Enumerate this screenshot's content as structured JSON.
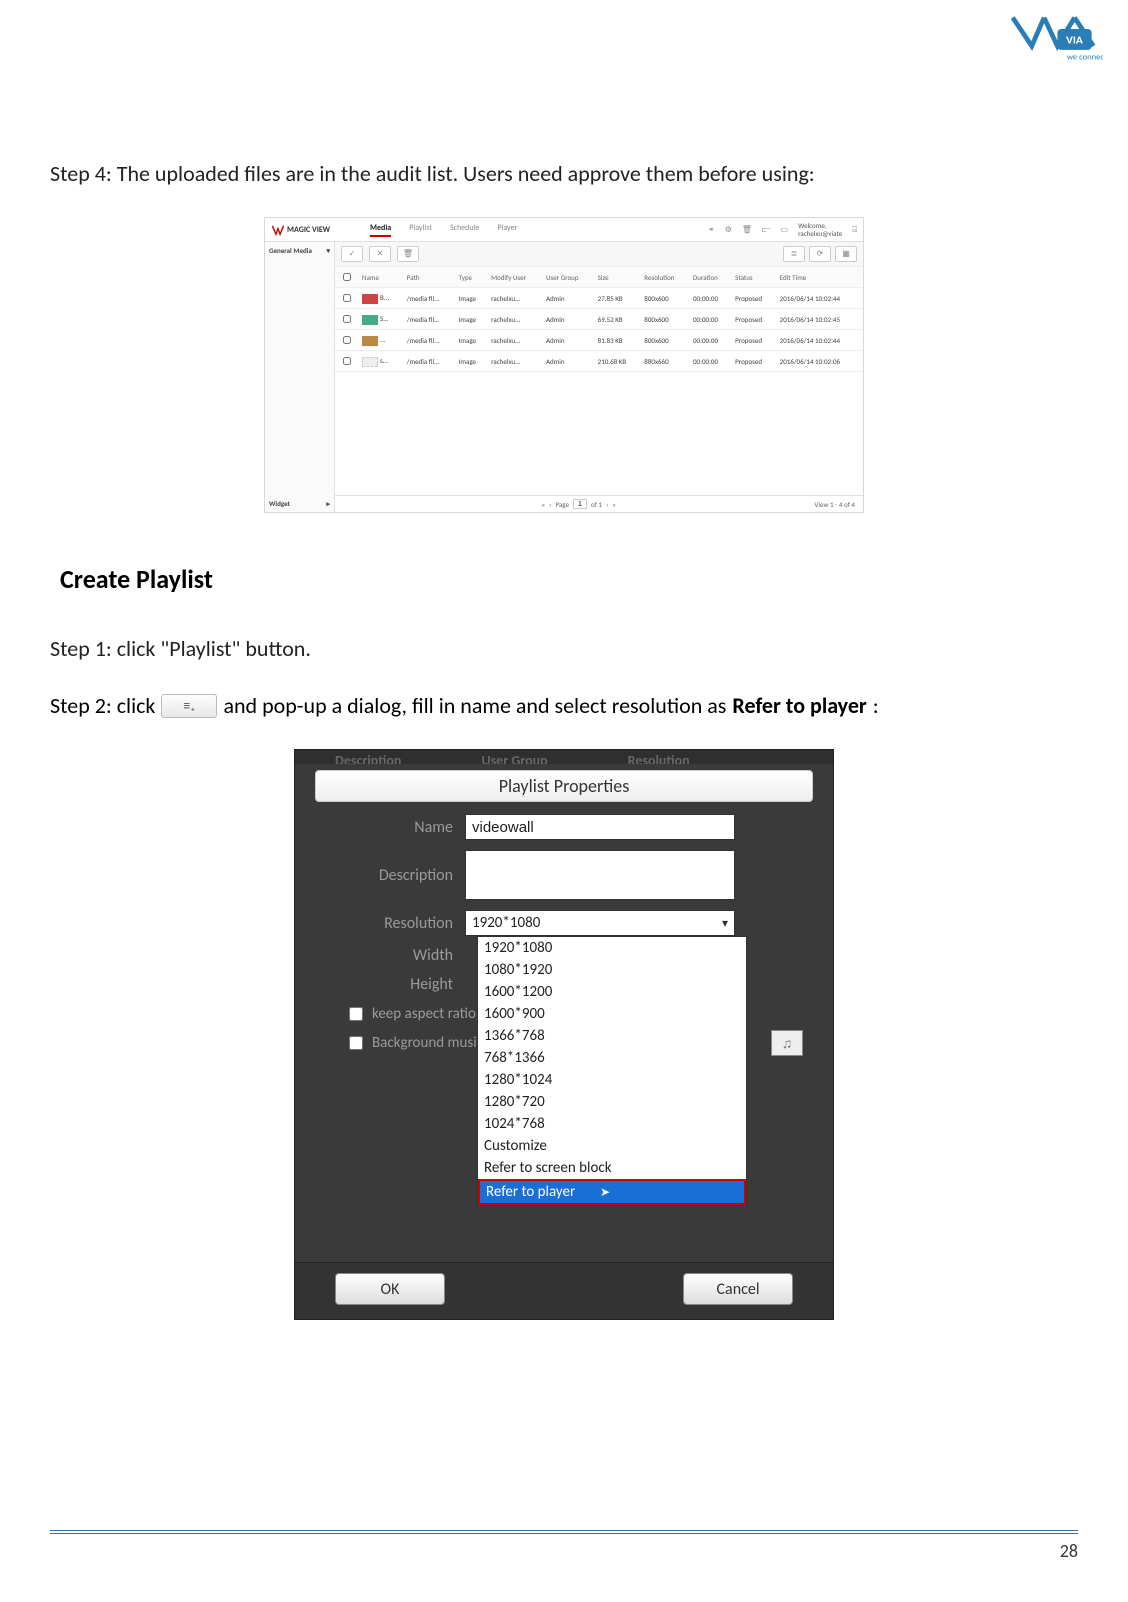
{
  "logo_tagline": "we connect",
  "step4_text": "Step 4: The uploaded files are in the audit list. Users need approve them before using:",
  "section_title": "Create Playlist",
  "step1_text": "Step 1: click \"Playlist\" button.",
  "step2_prefix": "Step 2: click",
  "step2_suffix": "and pop-up a dialog, fill in name and select resolution as",
  "step2_bold": "Refer to player",
  "step2_colon": ":",
  "page_number": "28",
  "app1": {
    "logo_text": "MAGIC VIEW",
    "tabs": [
      "Media",
      "Playlist",
      "Schedule",
      "Player"
    ],
    "active_tab": 0,
    "welcome": "Welcome,",
    "welcome_user": "rachelxu@viate",
    "sidebar": {
      "top": "General Media",
      "bottom": "Widget"
    },
    "columns": [
      "",
      "Name",
      "Path",
      "Type",
      "Modify User",
      "User Group",
      "Size",
      "Resolution",
      "Duration",
      "Status",
      "Edit Time"
    ],
    "rows": [
      {
        "name": "B...",
        "path": "/media fil...",
        "type": "Image",
        "user": "rachelxu...",
        "group": "Admin",
        "size": "27.85 KB",
        "res": "800x600",
        "dur": "00:00:00",
        "status": "Proposed",
        "time": "2016/06/14 10:02:44"
      },
      {
        "name": "S...",
        "path": "/media fil...",
        "type": "Image",
        "user": "rachelxu...",
        "group": "Admin",
        "size": "69.52 KB",
        "res": "800x600",
        "dur": "00:00:00",
        "status": "Proposed",
        "time": "2016/06/14 10:02:45"
      },
      {
        "name": "...",
        "path": "/media fil...",
        "type": "Image",
        "user": "rachelxu...",
        "group": "Admin",
        "size": "81.83 KB",
        "res": "800x600",
        "dur": "00:00:00",
        "status": "Proposed",
        "time": "2016/06/14 10:02:44"
      },
      {
        "name": "s...",
        "path": "/media fil...",
        "type": "Image",
        "user": "rachelxu...",
        "group": "Admin",
        "size": "210.68 KB",
        "res": "880x660",
        "dur": "00:00:00",
        "status": "Proposed",
        "time": "2016/06/14 10:02:06"
      }
    ],
    "pager": {
      "label_pre": "Page",
      "current": "1",
      "label_post": "of 1",
      "view": "View 1 - 4 of 4"
    }
  },
  "app2": {
    "bg_tabs": [
      "Description",
      "User Group",
      "Resolution"
    ],
    "title": "Playlist Properties",
    "fields": {
      "name_label": "Name",
      "name_value": "videowall",
      "desc_label": "Description",
      "desc_value": "",
      "res_label": "Resolution",
      "res_selected": "1920*1080",
      "width_label": "Width",
      "height_label": "Height",
      "keep_ratio": "keep aspect ratio",
      "bg_music": "Background music",
      "music_value": ""
    },
    "options": [
      "1920*1080",
      "1080*1920",
      "1600*1200",
      "1600*900",
      "1366*768",
      "768*1366",
      "1280*1024",
      "1280*720",
      "1024*768",
      "Customize",
      "Refer to screen block",
      "Refer to player"
    ],
    "highlight_index": 11,
    "ok": "OK",
    "cancel": "Cancel"
  }
}
